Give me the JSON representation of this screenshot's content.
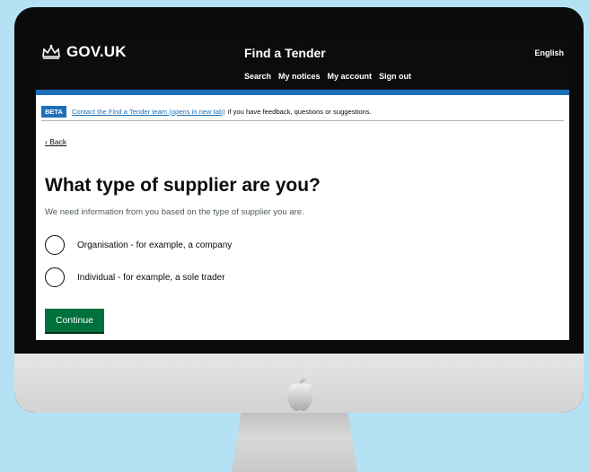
{
  "header": {
    "logo_text": "GOV.UK",
    "service_name": "Find a Tender",
    "nav": [
      "Search",
      "My notices",
      "My account",
      "Sign out"
    ],
    "language": "English"
  },
  "phase_banner": {
    "tag": "BETA",
    "link_text": "Contact the Find a Tender team (opens in new tab)",
    "text": "if you have feedback, questions or suggestions."
  },
  "back_link": "Back",
  "page": {
    "heading": "What type of supplier are you?",
    "hint": "We need information from you based on the type of supplier you are.",
    "options": [
      "Organisation - for example, a company",
      "Individual - for example, a sole trader"
    ],
    "continue_label": "Continue"
  },
  "colors": {
    "header_bg": "#0b0c0c",
    "brand_blue": "#1d70b8",
    "button_green": "#00703c",
    "background": "#b4e2f4"
  },
  "icons": {
    "logo": "crown-icon",
    "monitor_logo": "apple-icon"
  }
}
